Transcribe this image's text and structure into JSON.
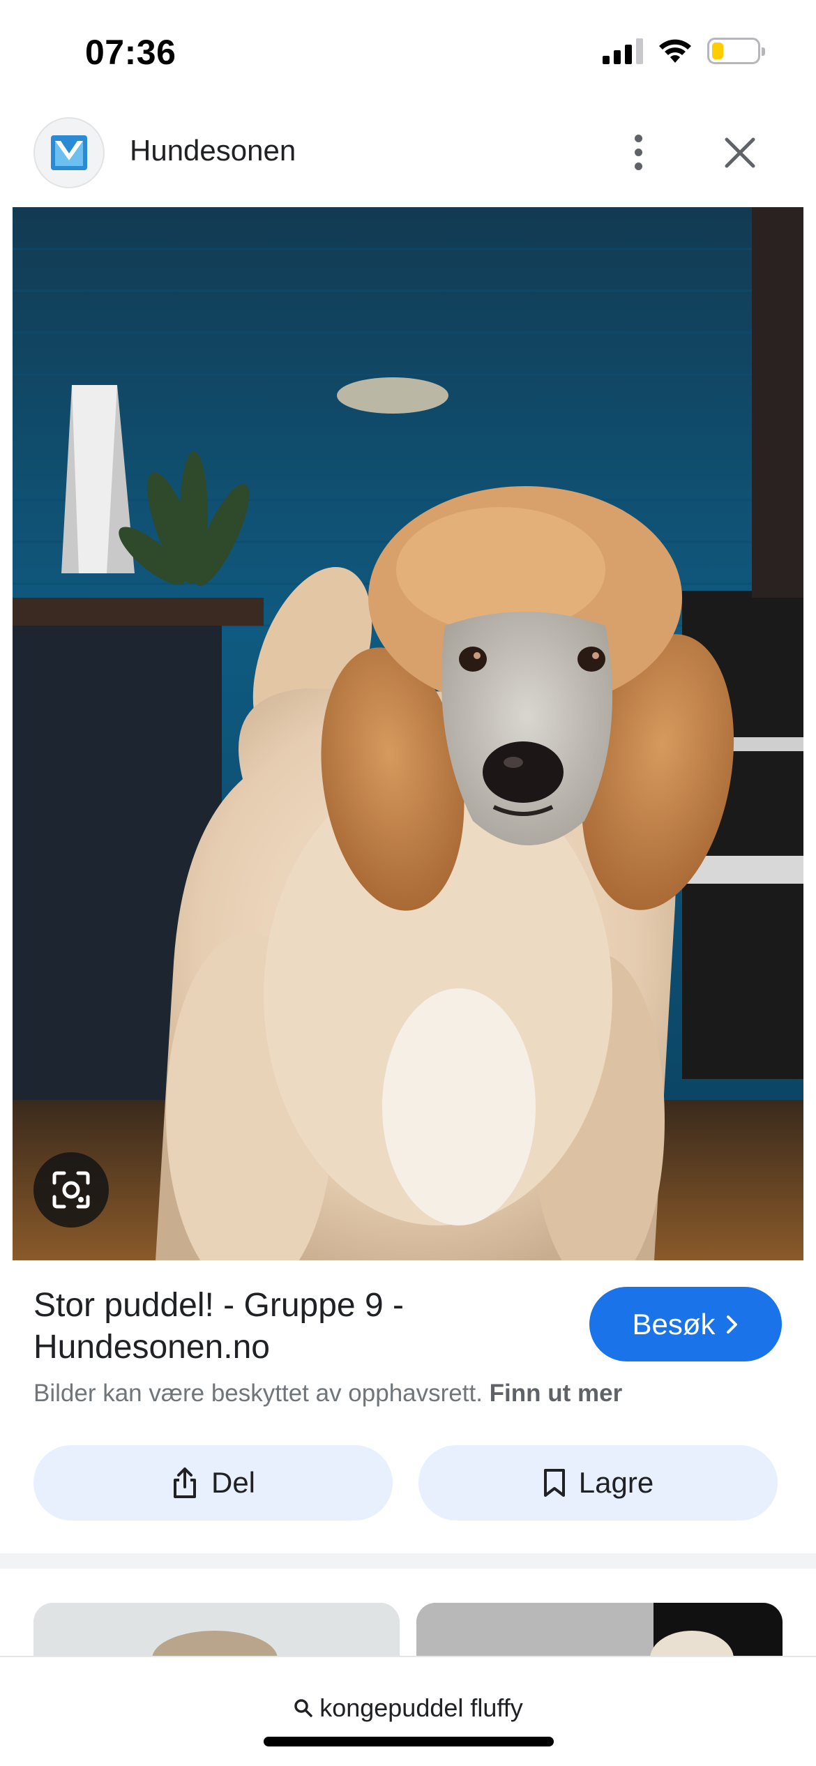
{
  "status_bar": {
    "time": "07:36",
    "battery_level_percent": 25,
    "icons": [
      "cellular-signal-icon",
      "wifi-icon",
      "battery-icon"
    ]
  },
  "header": {
    "site_name": "Hundesonen",
    "icons": [
      "site-logo-icon",
      "more-vert-icon",
      "close-icon"
    ]
  },
  "result": {
    "title": "Stor puddel! - Gruppe 9 - Hundesonen.no",
    "visit_label": "Besøk",
    "copyright_text": "Bilder kan være beskyttet av opphavsrett.",
    "learn_more": "Finn ut mer",
    "share_label": "Del",
    "save_label": "Lagre"
  },
  "search": {
    "query": "kongepuddel fluffy"
  },
  "colors": {
    "accent_blue": "#1a73e8",
    "chip_background": "#e8f0fe",
    "battery_yellow": "#ffcc00"
  }
}
